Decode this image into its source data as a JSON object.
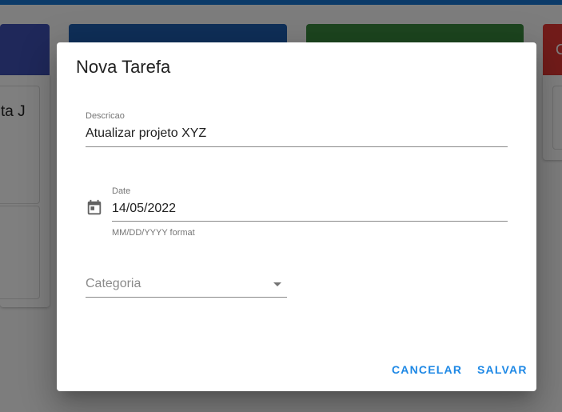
{
  "background": {
    "topbar_color": "#1976d2",
    "columns": [
      {
        "color": "#3f51b5"
      },
      {
        "color": "#1e5fb0"
      },
      {
        "color": "#3a8a3e"
      },
      {
        "color": "#e53935",
        "label_fragment": "C"
      }
    ],
    "card_text_fragment": "ta J"
  },
  "dialog": {
    "title": "Nova Tarefa",
    "descricao": {
      "label": "Descricao",
      "value": "Atualizar projeto XYZ"
    },
    "date": {
      "label": "Date",
      "value": "14/05/2022",
      "helper": "MM/DD/YYYY format",
      "icon": "calendar-icon"
    },
    "categoria": {
      "placeholder": "Categoria",
      "icon": "dropdown-caret-icon"
    },
    "actions": {
      "cancel_label": "CANCELAR",
      "save_label": "SALVAR"
    },
    "accent_color": "#1e88e5"
  }
}
